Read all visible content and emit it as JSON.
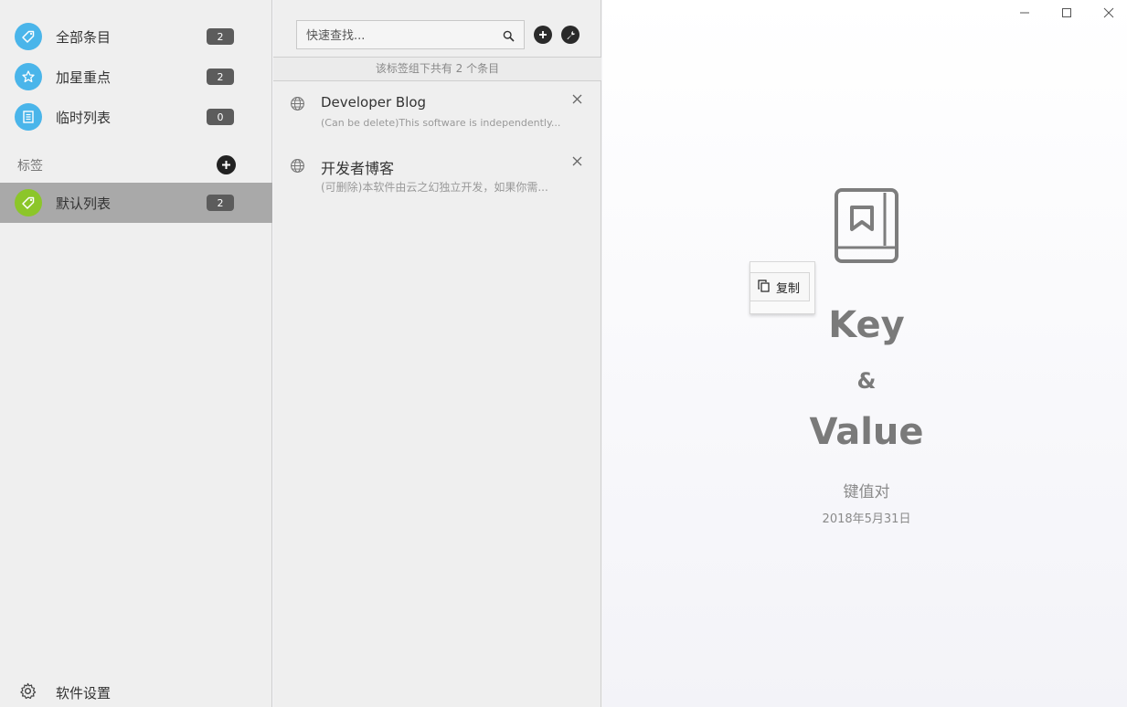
{
  "sidebar": {
    "items": [
      {
        "label": "全部条目",
        "count": "2",
        "icon": "tag-icon"
      },
      {
        "label": "加星重点",
        "count": "2",
        "icon": "star-icon"
      },
      {
        "label": "临时列表",
        "count": "0",
        "icon": "list-icon"
      }
    ],
    "tags_header": "标签",
    "tags": [
      {
        "label": "默认列表",
        "count": "2",
        "icon": "tag-icon",
        "selected": true
      }
    ],
    "settings_label": "软件设置"
  },
  "list": {
    "search_placeholder": "快速查找...",
    "count_text": "该标签组下共有 2 个条目",
    "entries": [
      {
        "title": "Developer Blog",
        "desc": "(Can be delete)This software is independently..."
      },
      {
        "title": "开发者博客",
        "desc": "(可删除)本软件由云之幻独立开发，如果你需..."
      }
    ]
  },
  "detail": {
    "line1": "Key",
    "line2": "&",
    "line3": "Value",
    "subtitle": "键值对",
    "date": "2018年5月31日"
  },
  "popup": {
    "copy_label": "复制"
  },
  "colors": {
    "accent_blue": "#4ab5ea",
    "accent_green": "#8cc62a",
    "selected_bg": "#a9a9a9",
    "badge_bg": "#5c5c5c"
  }
}
